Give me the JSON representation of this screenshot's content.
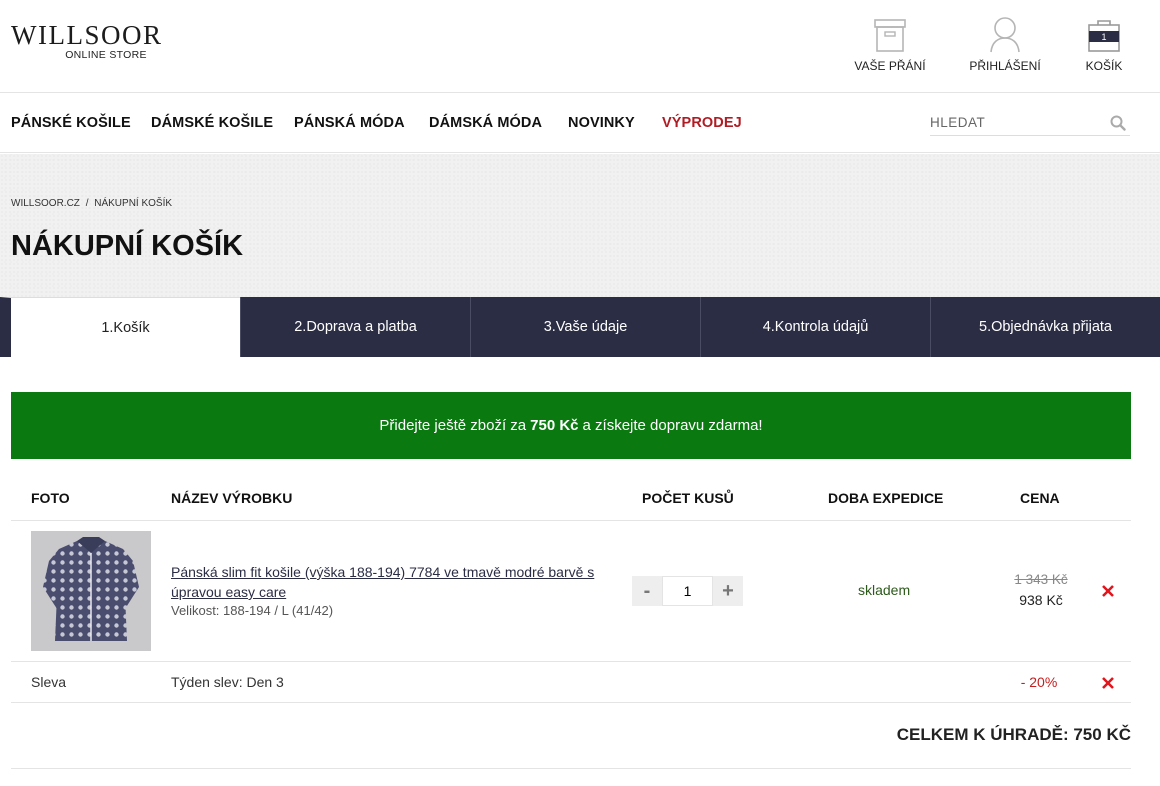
{
  "header": {
    "logo_main": "WILLSOOR",
    "logo_sub": "ONLINE STORE",
    "wishlist_label": "VAŠE PŘÁNÍ",
    "login_label": "PŘIHLÁŠENÍ",
    "cart_label": "KOŠÍK",
    "cart_count": "1"
  },
  "nav": {
    "items": [
      "PÁNSKÉ KOŠILE",
      "DÁMSKÉ KOŠILE",
      "PÁNSKÁ MÓDA",
      "DÁMSKÁ MÓDA",
      "NOVINKY",
      "VÝPRODEJ"
    ],
    "search_placeholder": "HLEDAT",
    "sale_color": "#b01c23"
  },
  "breadcrumb": {
    "home": "WILLSOOR.CZ",
    "separator": "/",
    "current": "NÁKUPNÍ KOŠÍK"
  },
  "page_title": "NÁKUPNÍ KOŠÍK",
  "steps": [
    "1.Košík",
    "2.Doprava a platba",
    "3.Vaše údaje",
    "4.Kontrola údajů",
    "5.Objednávka přijata"
  ],
  "banner": {
    "prefix": "Přidejte ještě zboží za",
    "amount": "750 Kč",
    "suffix": "a získejte dopravu zdarma!",
    "color": "#0a7a10"
  },
  "table": {
    "headers": {
      "photo": "FOTO",
      "name": "NÁZEV VÝROBKU",
      "quantity": "POČET KUSŮ",
      "shipping": "DOBA EXPEDICE",
      "price": "CENA"
    },
    "item": {
      "name": "Pánská slim fit košile (výška 188-194) 7784 ve tmavě modré barvě s úpravou easy care",
      "size": "Velikost: 188-194 / L (41/42)",
      "quantity": "1",
      "minus": "-",
      "plus": "+",
      "availability": "skladem",
      "old_price": "1 343 Kč",
      "price": "938 Kč"
    },
    "discount": {
      "label": "Sleva",
      "name": "Týden slev: Den 3",
      "value": "- 20%"
    }
  },
  "total": "CELKEM K ÚHRADĚ: 750 KČ"
}
